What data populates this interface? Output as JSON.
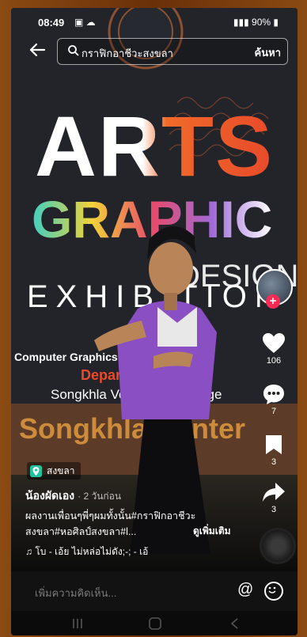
{
  "status_bar": {
    "time": "08:49",
    "right_text": "90%"
  },
  "search": {
    "query": "กราฟิกอาชีวะสงขลา",
    "action_label": "ค้นหา"
  },
  "sidebar": {
    "likes": "106",
    "comments": "7",
    "saves": "3",
    "shares": "3"
  },
  "location": {
    "label": "สงขลา"
  },
  "post": {
    "author": "น้องผัดเอง",
    "posted_ago": "· 2 วันก่อน",
    "caption_line1": "ผลงานเพื่อนๆพี่ๆผมทั้งนั้น#กราฟิกอาชีวะ",
    "caption_line2": "สงขลา#หอศิลป์สงขลา#l...",
    "see_more": "ดูเพิ่มเติม",
    "music": "♫ โบ - เอ้ย ไม่หล่อไม่ดัง;-; - เอ้"
  },
  "comment_bar": {
    "placeholder": "เพิ่มความคิดเห็น..."
  },
  "poster": {
    "line1": "ARTS",
    "line2": "GRAPHIC",
    "line3": "DESIGN",
    "line4": "EXHIBITION",
    "line5": "Computer Graphics Major",
    "line6": "Department",
    "line7": "Songkhla Vocational College",
    "line8": "Songkhla Center"
  },
  "colors": {
    "accent": "#fe2c55",
    "location_pin": "#1ec4a0",
    "poster_red": "#e84a2a",
    "shirt_purple": "#8b4fc4"
  }
}
